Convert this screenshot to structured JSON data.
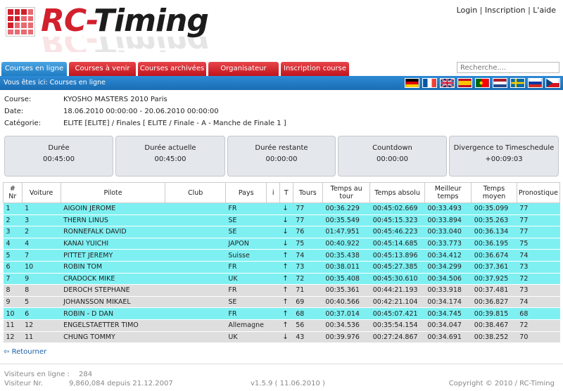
{
  "header": {
    "logo_rc": "RC",
    "logo_dash": "-",
    "logo_timing": "Timing",
    "links": {
      "login": "Login",
      "sep1": " | ",
      "register": "Inscription",
      "sep2": " | ",
      "help": "L'aide"
    }
  },
  "tabs": [
    "Courses en ligne",
    "Courses à venir",
    "Courses archivées",
    "Organisateur",
    "Inscription course"
  ],
  "search": {
    "placeholder": "Recherche...."
  },
  "breadcrumb": "Vous êtes ici: Courses en ligne",
  "flags": [
    "germany-flag",
    "france-flag",
    "uk-flag",
    "spain-flag",
    "portugal-flag",
    "netherlands-flag",
    "sweden-flag",
    "russia-flag",
    "czech-flag"
  ],
  "info": {
    "course_label": "Course:",
    "course": "KYOSHO MASTERS 2010 Paris",
    "date_label": "Date:",
    "date": "18.06.2010 00:00:00 - 20.06.2010 00:00:00",
    "category_label": "Catégorie:",
    "category": "ELITE [ELITE] / Finales [ ELITE / Finale - A - Manche de Finale 1 ]"
  },
  "timers": [
    {
      "label": "Durée",
      "value": "00:45:00"
    },
    {
      "label": "Durée actuelle",
      "value": "00:45:00"
    },
    {
      "label": "Durée restante",
      "value": "00:00:00"
    },
    {
      "label": "Countdown",
      "value": "00:00:00"
    },
    {
      "label": "Divergence to Timeschedule",
      "value": "+00:09:03"
    }
  ],
  "table": {
    "headers": [
      "# Nr",
      "Voiture",
      "Pilote",
      "Club",
      "Pays",
      "i",
      "T",
      "Tours",
      "Temps au tour",
      "Temps absolu",
      "Meilleur temps",
      "Temps moyen",
      "Pronostique"
    ],
    "rows": [
      {
        "nr": "1",
        "car": "1",
        "pilot": "AIGOIN JEROME",
        "club": "",
        "country": "FR",
        "i": "",
        "trend": "↓",
        "laps": "77",
        "lap": "00:36.229",
        "abs": "00:45:02.669",
        "best": "00:33.493",
        "avg": "00:35.099",
        "prog": "77",
        "color": "cyan"
      },
      {
        "nr": "2",
        "car": "3",
        "pilot": "THERN LINUS",
        "club": "",
        "country": "SE",
        "i": "",
        "trend": "↓",
        "laps": "77",
        "lap": "00:35.549",
        "abs": "00:45:15.323",
        "best": "00:33.894",
        "avg": "00:35.263",
        "prog": "77",
        "color": "cyan"
      },
      {
        "nr": "3",
        "car": "2",
        "pilot": "RONNEFALK DAVID",
        "club": "",
        "country": "SE",
        "i": "",
        "trend": "↓",
        "laps": "76",
        "lap": "01:47.951",
        "abs": "00:45:46.223",
        "best": "00:33.040",
        "avg": "00:36.134",
        "prog": "77",
        "color": "cyan"
      },
      {
        "nr": "4",
        "car": "4",
        "pilot": "KANAI YUICHI",
        "club": "",
        "country": "JAPON",
        "i": "",
        "trend": "↓",
        "laps": "75",
        "lap": "00:40.922",
        "abs": "00:45:14.685",
        "best": "00:33.773",
        "avg": "00:36.195",
        "prog": "75",
        "color": "cyan"
      },
      {
        "nr": "5",
        "car": "7",
        "pilot": "PITTET JEREMY",
        "club": "",
        "country": "Suisse",
        "i": "",
        "trend": "↑",
        "laps": "74",
        "lap": "00:35.438",
        "abs": "00:45:13.896",
        "best": "00:34.412",
        "avg": "00:36.674",
        "prog": "74",
        "color": "cyan"
      },
      {
        "nr": "6",
        "car": "10",
        "pilot": "ROBIN TOM",
        "club": "",
        "country": "FR",
        "i": "",
        "trend": "↑",
        "laps": "73",
        "lap": "00:38.011",
        "abs": "00:45:27.385",
        "best": "00:34.299",
        "avg": "00:37.361",
        "prog": "73",
        "color": "cyan"
      },
      {
        "nr": "7",
        "car": "9",
        "pilot": "CRADOCK MIKE",
        "club": "",
        "country": "UK",
        "i": "",
        "trend": "↑",
        "laps": "72",
        "lap": "00:35.408",
        "abs": "00:45:30.610",
        "best": "00:34.506",
        "avg": "00:37.925",
        "prog": "72",
        "color": "cyan"
      },
      {
        "nr": "8",
        "car": "8",
        "pilot": "DEROCH STEPHANE",
        "club": "",
        "country": "FR",
        "i": "",
        "trend": "↑",
        "laps": "71",
        "lap": "00:35.361",
        "abs": "00:44:21.193",
        "best": "00:33.918",
        "avg": "00:37.481",
        "prog": "73",
        "color": "gray"
      },
      {
        "nr": "9",
        "car": "5",
        "pilot": "JOHANSSON MIKAEL",
        "club": "",
        "country": "SE",
        "i": "",
        "trend": "↑",
        "laps": "69",
        "lap": "00:40.566",
        "abs": "00:42:21.104",
        "best": "00:34.174",
        "avg": "00:36.827",
        "prog": "74",
        "color": "gray"
      },
      {
        "nr": "10",
        "car": "6",
        "pilot": "ROBIN - D DAN",
        "club": "",
        "country": "FR",
        "i": "",
        "trend": "↑",
        "laps": "68",
        "lap": "00:37.014",
        "abs": "00:45:07.421",
        "best": "00:34.745",
        "avg": "00:39.815",
        "prog": "68",
        "color": "cyan"
      },
      {
        "nr": "11",
        "car": "12",
        "pilot": "ENGELSTAETTER TIMO",
        "club": "",
        "country": "Allemagne",
        "i": "",
        "trend": "↑",
        "laps": "56",
        "lap": "00:34.536",
        "abs": "00:35:54.154",
        "best": "00:34.047",
        "avg": "00:38.467",
        "prog": "72",
        "color": "gray"
      },
      {
        "nr": "12",
        "car": "11",
        "pilot": "CHUNG TOMMY",
        "club": "",
        "country": "UK",
        "i": "",
        "trend": "↓",
        "laps": "43",
        "lap": "00:39.976",
        "abs": "00:27:24.867",
        "best": "00:34.691",
        "avg": "00:38.252",
        "prog": "70",
        "color": "gray"
      }
    ]
  },
  "back_label": "Retourner",
  "footer": {
    "visitors_label": "Visiteurs en ligne :",
    "visitors": "284",
    "visitor_nr_label": "Visiteur Nr.",
    "visitor_nr": "9,860,084 depuis 21.12.2007",
    "version": "v1.5.9 ( 11.06.2010 )",
    "copyright": "Copyright © 2010 / RC-Timing"
  }
}
